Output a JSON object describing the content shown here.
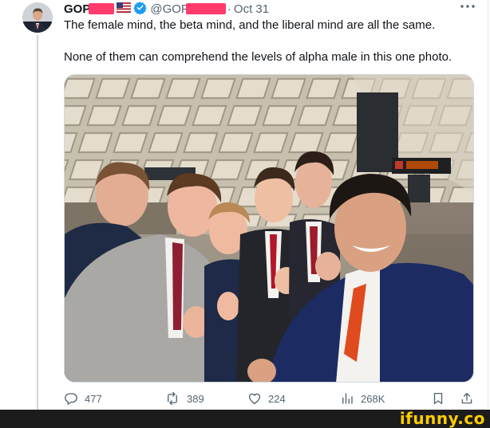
{
  "tweet": {
    "display_name": "GOP",
    "handle": "@GOP",
    "separator": "·",
    "date": "Oct 31",
    "lines": [
      "The female mind, the beta mind, and the liberal mind are all the same.",
      "None of them can comprehend the levels of alpha male in this one photo."
    ]
  },
  "metrics": {
    "replies": "477",
    "reposts": "389",
    "likes": "224",
    "views": "268K"
  },
  "watermark": "ifunny.co",
  "colors": {
    "text": "#0f1419",
    "secondary": "#536471",
    "verified": "#1d9bf0",
    "redaction": "#ff3b6b",
    "watermark": "#ffcc00"
  },
  "icons": [
    "flag-icon",
    "verified-icon",
    "more-icon",
    "reply-icon",
    "repost-icon",
    "like-icon",
    "views-icon",
    "bookmark-icon",
    "share-icon"
  ]
}
